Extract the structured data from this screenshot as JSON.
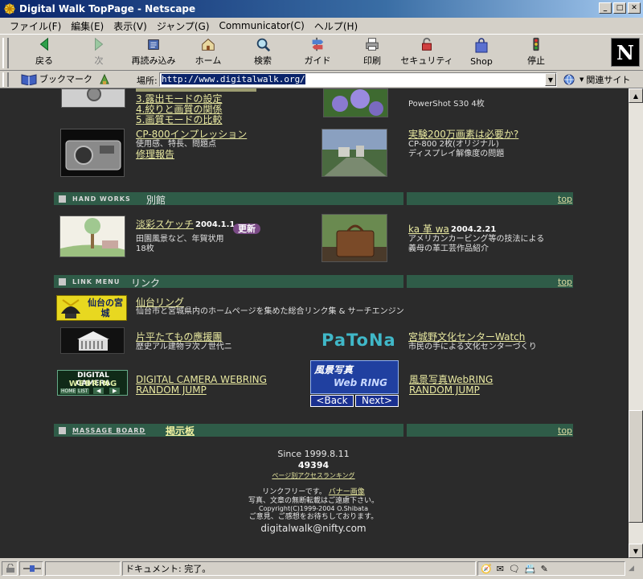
{
  "window": {
    "title": "Digital Walk TopPage - Netscape"
  },
  "menu": [
    "ファイル(F)",
    "編集(E)",
    "表示(V)",
    "ジャンプ(G)",
    "Communicator(C)",
    "ヘルプ(H)"
  ],
  "toolbar": {
    "back": "戻る",
    "forward": "次",
    "reload": "再読み込み",
    "home": "ホーム",
    "search": "検索",
    "guide": "ガイド",
    "print": "印刷",
    "security": "セキュリティ",
    "shop": "Shop",
    "stop": "停止"
  },
  "location": {
    "bookmarks": "ブックマーク",
    "label": "場所:",
    "url": "http://www.digitalwalk.org/",
    "related": "関連サイト"
  },
  "content": {
    "top_items": {
      "item3": "3.露出モードの設定",
      "item4": "4.絞りと画質の関係",
      "item5": "5.画質モードの比較",
      "powershot": "PowerShot S30  4枚"
    },
    "cp800": {
      "title": "CP-800インプレッション",
      "desc": "使用感、特長、問題点",
      "repair": "修理報告"
    },
    "experiment": {
      "title": "実験200万画素は必要か?",
      "desc1": "CP-800  2枚(オリジナル)",
      "desc2": "ディスプレイ解像度の問題"
    },
    "handworks": {
      "en": "HAND WORKS",
      "jp": "別館",
      "top": "top",
      "sketch_title": "淡彩スケッチ",
      "sketch_date": "2004.1.1",
      "new_badge": "更新",
      "sketch_desc1": "田園風景など、年賀状用",
      "sketch_desc2": "18枚",
      "kawa_title": "ka  革  wa",
      "kawa_date": "2004.2.21",
      "kawa_desc1": "アメリカンカービング等の技法による",
      "kawa_desc2": "義母の革工芸作品紹介"
    },
    "linkmenu": {
      "en": "LINK  MENU",
      "jp": "リンク",
      "top": "top",
      "sendai_logo": "仙台の宮城",
      "sendai_title": "仙台リング",
      "sendai_desc": "仙台市と宮城県内のホームページを集めた総合リンク集 & サーチエンジン",
      "katahira_title": "片平たてもの應援團",
      "katahira_desc": "歴史アル建物ヲ次ノ世代ニ",
      "patona_logo": "PaToNa",
      "miyagino_title": "宮城野文化センターWatch",
      "miyagino_desc": "市民の手による文化センターづくり",
      "dcw_logo_line1": "DIGITAL CAMERA",
      "dcw_logo_line2": "WEBRING",
      "dcw_logo_home": "HOME",
      "dcw_logo_list": "LIST",
      "dcw_title": "DIGITAL CAMERA WEBRING",
      "dcw_jump": "RANDOM JUMP",
      "fukei_logo_line1": "風景写真",
      "fukei_logo_line2": "Web RING",
      "fukei_back": "<Back",
      "fukei_next": "Next>",
      "fukei_title": "風景写真WebRING",
      "fukei_jump": "RANDOM JUMP"
    },
    "massage": {
      "en": "MASSAGE  BOARD",
      "jp": "掲示板",
      "top": "top"
    },
    "footer": {
      "since": "Since 1999.8.11",
      "count": "49394",
      "ranking": "ページ別アクセスランキング",
      "linkfree": "リンクフリーです。",
      "banner": "バナー画像",
      "notice": "写真、文章の無断転載はご遠慮下さい。",
      "copyright": "Copyright(C)1999-2004 O.Shibata",
      "opinion": "ご意見、ご感想をお待ちしております。",
      "email": "digitalwalk@nifty.com"
    }
  },
  "status": {
    "text": "ドキュメント: 完了。"
  }
}
